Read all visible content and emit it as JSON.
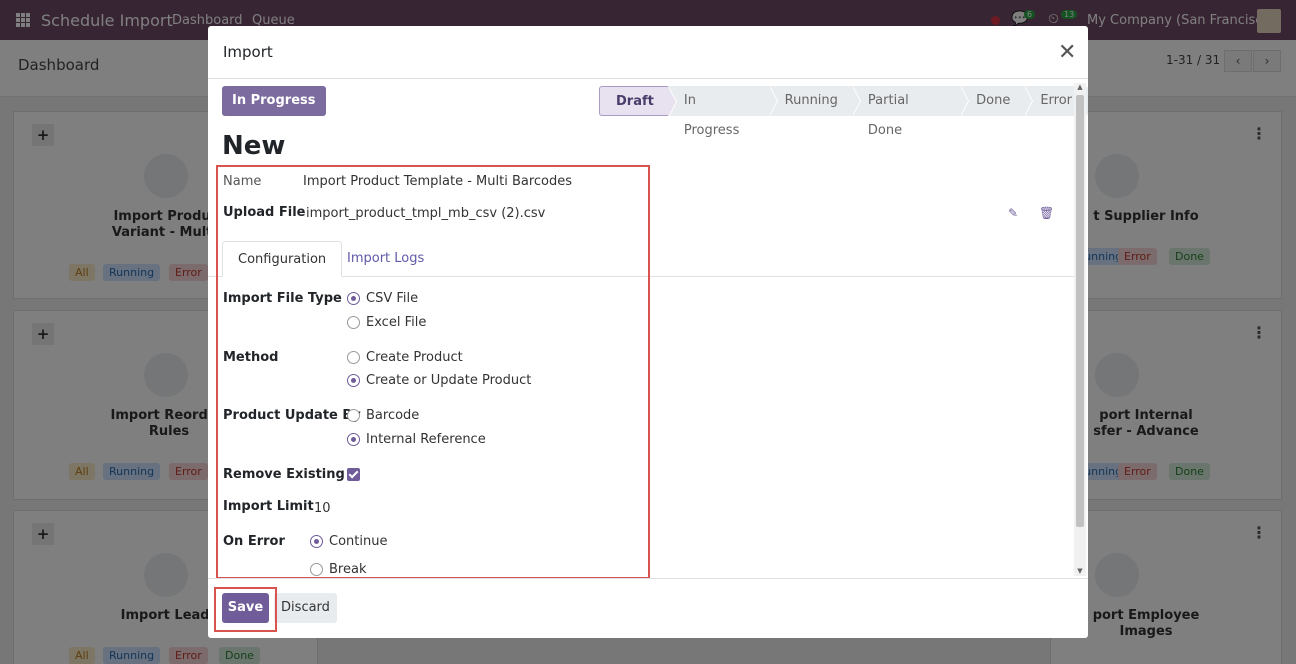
{
  "navbar": {
    "app_title": "Schedule Import",
    "menu": [
      "Dashboard",
      "Queue"
    ],
    "messages_count": "6",
    "activities_count": "13",
    "company": "My Company (San Francisco)"
  },
  "control": {
    "breadcrumb": "Dashboard",
    "pager": "1-31 / 31"
  },
  "cards": {
    "labels": {
      "c1": "Import Product\nVariant - Multip",
      "c2": "Import Reorderi\nRules",
      "c3": "Import Leads",
      "c4": "t Supplier Info",
      "c5": "port Internal\nsfer - Advance",
      "c6": "port Employee\nImages"
    },
    "tags": {
      "all": "All",
      "running": "Running",
      "error": "Error",
      "done": "Done"
    }
  },
  "modal": {
    "title": "Import",
    "state_button": "In Progress",
    "stages": [
      "Draft",
      "In Progress",
      "Running",
      "Partial Done",
      "Done",
      "Error"
    ],
    "record_title": "New",
    "fields": {
      "name_label": "Name",
      "name_value": "Import Product Template - Multi Barcodes",
      "upload_label": "Upload File",
      "upload_value": "import_product_tmpl_mb_csv (2).csv"
    },
    "tabs": [
      "Configuration",
      "Import Logs"
    ],
    "config": {
      "file_type_label": "Import File Type",
      "file_type_options": [
        "CSV File",
        "Excel File"
      ],
      "method_label": "Method",
      "method_options": [
        "Create Product",
        "Create or Update Product"
      ],
      "update_by_label": "Product Update By",
      "update_by_options": [
        "Barcode",
        "Internal Reference"
      ],
      "remove_existing_label": "Remove Existing",
      "import_limit_label": "Import Limit",
      "import_limit_value": "10",
      "on_error_label": "On Error",
      "on_error_options": [
        "Continue",
        "Break"
      ]
    },
    "footer": {
      "save": "Save",
      "discard": "Discard"
    }
  }
}
